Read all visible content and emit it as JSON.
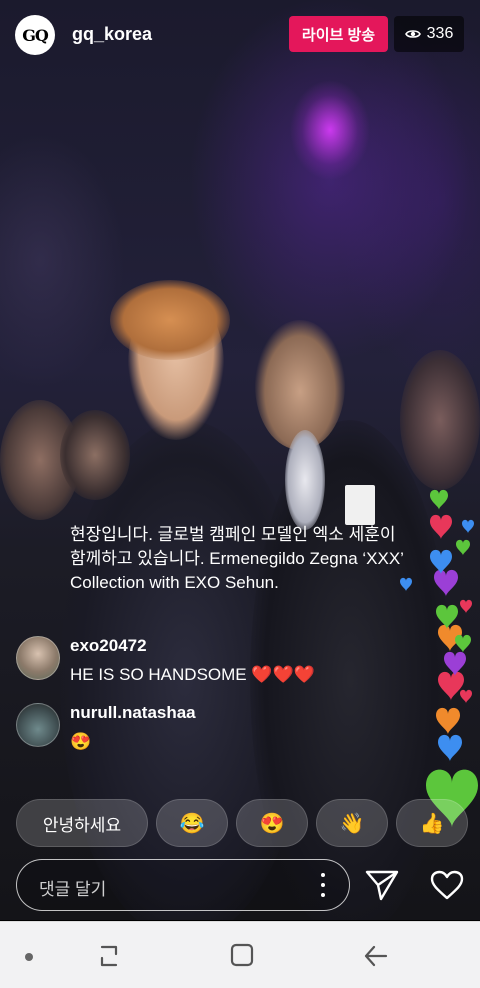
{
  "header": {
    "avatar_text": "GQ",
    "username": "gq_korea",
    "live_label": "라이브 방송",
    "viewer_count": "336",
    "viewer_icon": "eye-icon"
  },
  "caption": "현장입니다. 글로벌 캠페인 모델인 엑소 세훈이 함께하고 있습니다. Ermenegildo Zegna ‘XXX’ Collection with EXO Sehun.",
  "comments": [
    {
      "username": "exo20472",
      "text": "HE IS SO HANDSOME ❤️❤️❤️"
    },
    {
      "username": "nurull.natashaa",
      "text": "😍"
    }
  ],
  "quick_replies": [
    {
      "label": "안녕하세요"
    },
    {
      "label": "😂",
      "icon": "tears-of-joy-emoji-icon"
    },
    {
      "label": "😍",
      "icon": "heart-eyes-emoji-icon"
    },
    {
      "label": "👋",
      "icon": "waving-hand-emoji-icon"
    },
    {
      "label": "👍",
      "icon": "thumbs-up-emoji-icon"
    }
  ],
  "comment_input": {
    "placeholder": "댓글 달기"
  },
  "actions": {
    "send_icon": "send-icon",
    "like_icon": "heart-outline-icon",
    "more_icon": "more-vertical-icon"
  },
  "system_nav": {
    "icons": [
      "dot-icon",
      "recent-apps-icon",
      "home-icon",
      "back-icon"
    ]
  },
  "colors": {
    "live_badge": "#e4175b",
    "heart_green": "#5cc63c",
    "heart_red": "#e8375a",
    "heart_orange": "#f08a2c",
    "heart_blue": "#3d8ef0",
    "heart_purple": "#9b3fd6"
  }
}
